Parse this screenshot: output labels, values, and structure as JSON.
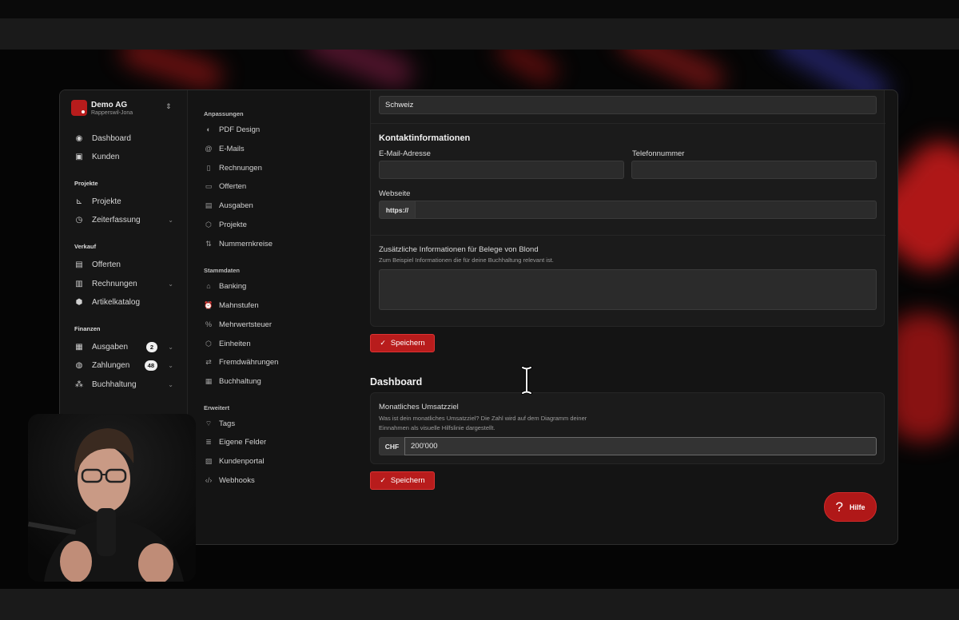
{
  "company": {
    "name": "Demo AG",
    "location": "Rapperswil-Jona"
  },
  "sidebar": {
    "top_items": [
      {
        "label": "Dashboard",
        "icon": "dashboard-icon"
      },
      {
        "label": "Kunden",
        "icon": "customers-icon"
      }
    ],
    "sections": [
      {
        "title": "Projekte",
        "items": [
          {
            "label": "Projekte",
            "icon": "chart-icon"
          },
          {
            "label": "Zeiterfassung",
            "icon": "clock-icon",
            "chevron": true
          }
        ]
      },
      {
        "title": "Verkauf",
        "items": [
          {
            "label": "Offerten",
            "icon": "quote-icon"
          },
          {
            "label": "Rechnungen",
            "icon": "invoice-icon",
            "chevron": true
          },
          {
            "label": "Artikelkatalog",
            "icon": "box-icon"
          }
        ]
      },
      {
        "title": "Finanzen",
        "items": [
          {
            "label": "Ausgaben",
            "icon": "receipt-icon",
            "badge": "2",
            "chevron": true
          },
          {
            "label": "Zahlungen",
            "icon": "payments-icon",
            "badge": "48",
            "chevron": true
          },
          {
            "label": "Buchhaltung",
            "icon": "ledger-icon",
            "chevron": true
          }
        ]
      }
    ]
  },
  "settings_nav": {
    "sections": [
      {
        "title": "Anpassungen",
        "items": [
          "PDF Design",
          "E-Mails",
          "Rechnungen",
          "Offerten",
          "Ausgaben",
          "Projekte",
          "Nummernkreise"
        ]
      },
      {
        "title": "Stammdaten",
        "items": [
          "Banking",
          "Mahnstufen",
          "Mehrwertsteuer",
          "Einheiten",
          "Fremdwährungen",
          "Buchhaltung"
        ]
      },
      {
        "title": "Erweitert",
        "items": [
          "Tags",
          "Eigene Felder",
          "Kundenportal",
          "Webhooks"
        ]
      }
    ]
  },
  "form": {
    "country_value": "Schweiz",
    "contact_title": "Kontaktinformationen",
    "email_label": "E-Mail-Adresse",
    "email_value": "",
    "phone_label": "Telefonnummer",
    "phone_value": "",
    "website_label": "Webseite",
    "website_prefix": "https://",
    "website_value": "",
    "extra_title": "Zusätzliche Informationen für Belege von Blond",
    "extra_hint": "Zum Beispiel Informationen die für deine Buchhaltung relevant ist.",
    "save_label": "Speichern"
  },
  "dashboard": {
    "title": "Dashboard",
    "goal_title": "Monatliches Umsatzziel",
    "goal_hint_1": "Was ist dein monatliches Umsatzziel? Die Zahl wird auf dem Diagramm deiner",
    "goal_hint_2": "Einnahmen als visuelle Hilfslinie dargestellt.",
    "currency": "CHF",
    "goal_value": "200'000",
    "save_label": "Speichern"
  },
  "help": {
    "label": "Hilfe"
  },
  "colors": {
    "accent": "#b81c1c",
    "background": "#141414"
  }
}
